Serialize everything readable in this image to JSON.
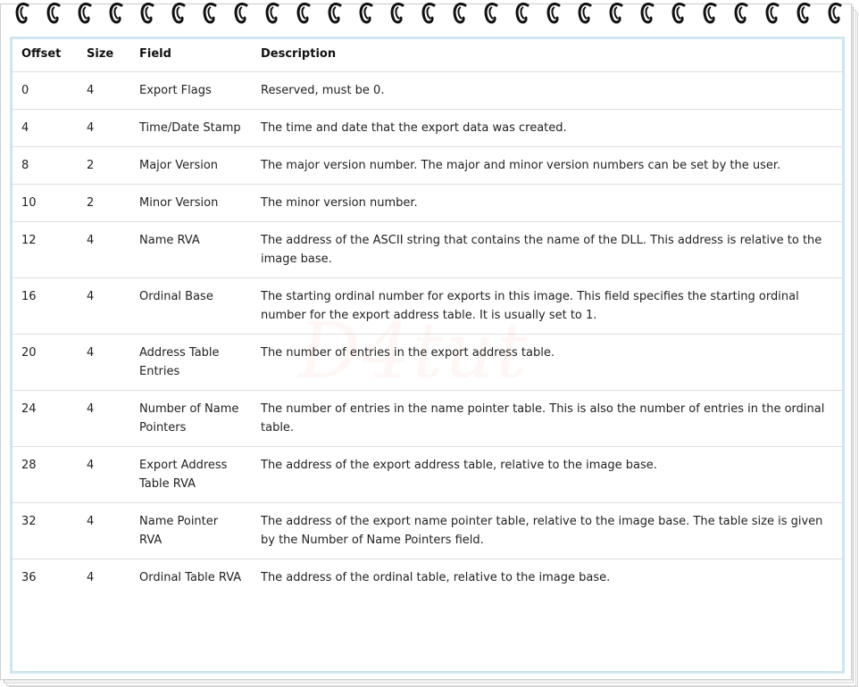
{
  "table": {
    "headers": [
      "Offset",
      "Size",
      "Field",
      "Description"
    ],
    "rows": [
      {
        "offset": "0",
        "size": "4",
        "field": "Export Flags",
        "description": "Reserved, must be 0."
      },
      {
        "offset": "4",
        "size": "4",
        "field": "Time/Date Stamp",
        "description": "The time and date that the export data was created."
      },
      {
        "offset": "8",
        "size": "2",
        "field": "Major Version",
        "description": "The major version number. The major and minor version numbers can be set by the user."
      },
      {
        "offset": "10",
        "size": "2",
        "field": "Minor Version",
        "description": "The minor version number."
      },
      {
        "offset": "12",
        "size": "4",
        "field": "Name RVA",
        "description": "The address of the ASCII string that contains the name of the DLL. This address is relative to the image base."
      },
      {
        "offset": "16",
        "size": "4",
        "field": "Ordinal Base",
        "description": "The starting ordinal number for exports in this image. This field specifies the starting ordinal number for the export address table. It is usually set to 1."
      },
      {
        "offset": "20",
        "size": "4",
        "field": "Address Table Entries",
        "description": "The number of entries in the export address table."
      },
      {
        "offset": "24",
        "size": "4",
        "field": "Number of Name Pointers",
        "description": "The number of entries in the name pointer table. This is also the number of entries in the ordinal table."
      },
      {
        "offset": "28",
        "size": "4",
        "field": "Export Address Table RVA",
        "description": "The address of the export address table, relative to the image base."
      },
      {
        "offset": "32",
        "size": "4",
        "field": "Name Pointer RVA",
        "description": "The address of the export name pointer table, relative to the image base. The table size is given by the Number of Name Pointers field."
      },
      {
        "offset": "36",
        "size": "4",
        "field": "Ordinal Table RVA",
        "description": "The address of the ordinal table, relative to the image base."
      }
    ]
  },
  "watermark": "D4tut",
  "colors": {
    "frame_border": "#cfe6f1",
    "ring": "#111111",
    "row_border": "#dedede"
  }
}
